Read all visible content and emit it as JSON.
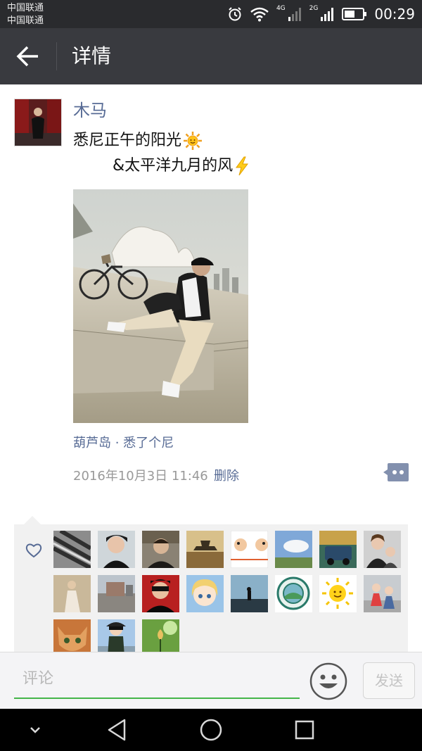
{
  "status_bar": {
    "carrier1": "中国联通",
    "carrier2": "中国联通",
    "net1": "4G",
    "net2": "2G",
    "time": "00:29"
  },
  "title_bar": {
    "title": "详情"
  },
  "post": {
    "author": "木马",
    "line1": "悉尼正午的阳光",
    "line2": "&太平洋九月的风",
    "location": "葫芦岛 · 悉了个尼",
    "time": "2016年10月3日 11:46",
    "delete_label": "删除"
  },
  "likes": {
    "avatars": [
      "like-avatar-1",
      "like-avatar-2",
      "like-avatar-3",
      "like-avatar-4",
      "like-avatar-5",
      "like-avatar-6",
      "like-avatar-7",
      "like-avatar-8",
      "like-avatar-9",
      "like-avatar-10",
      "like-avatar-11",
      "like-avatar-12",
      "like-avatar-13",
      "like-avatar-14",
      "like-avatar-15",
      "like-avatar-16",
      "like-avatar-17",
      "like-avatar-18",
      "like-avatar-19"
    ]
  },
  "comment_bar": {
    "placeholder": "评论",
    "send_label": "发送"
  },
  "colors": {
    "accent_link": "#576b95",
    "input_underline": "#44b549",
    "titlebar": "#393a3f"
  }
}
